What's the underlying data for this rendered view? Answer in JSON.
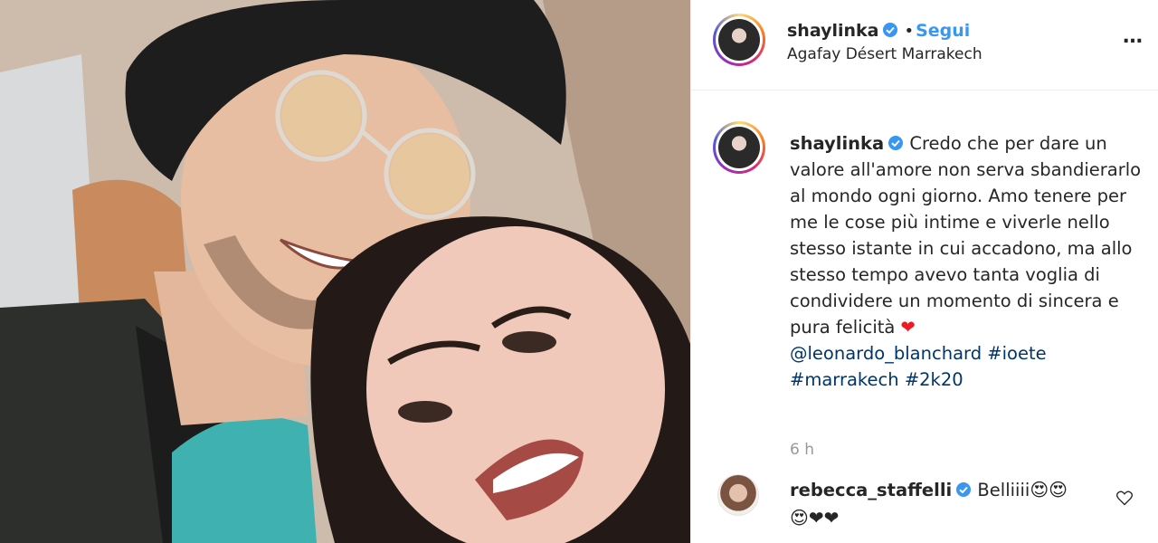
{
  "post": {
    "photo_alt": "selfie-photo",
    "header": {
      "username": "shaylinka",
      "dot": "•",
      "follow_label": "Segui",
      "location": "Agafay Désert Marrakech",
      "more_icon": "…"
    },
    "caption": {
      "username": "shaylinka",
      "text_line_1": "Credo che per dare un",
      "text_body": "valore all'amore non serva sbandierarlo al mondo ogni giorno. Amo tenere per me le cose più intime e viverle nello stesso istante in cui accadono, ma allo stesso tempo avevo tanta voglia di condividere un momento di sincera e pura felicità",
      "heart": "❤",
      "mention": "@leonardo_blanchard",
      "hashtags": [
        "#ioete",
        "#marrakech",
        "#2k20"
      ]
    },
    "time": "6 h",
    "comment": {
      "username": "rebecca_staffelli",
      "text": "Belliiii",
      "emojis_line_1": "😍😍",
      "emojis_line_2": "😍❤❤"
    }
  },
  "colors": {
    "accent_link": "#3897f0",
    "hashtag": "#003569",
    "heart": "#ed1c24",
    "muted": "#999999"
  },
  "icons": {
    "verified": "verified-badge-icon",
    "more": "more-options-icon",
    "like": "heart-outline-icon"
  }
}
